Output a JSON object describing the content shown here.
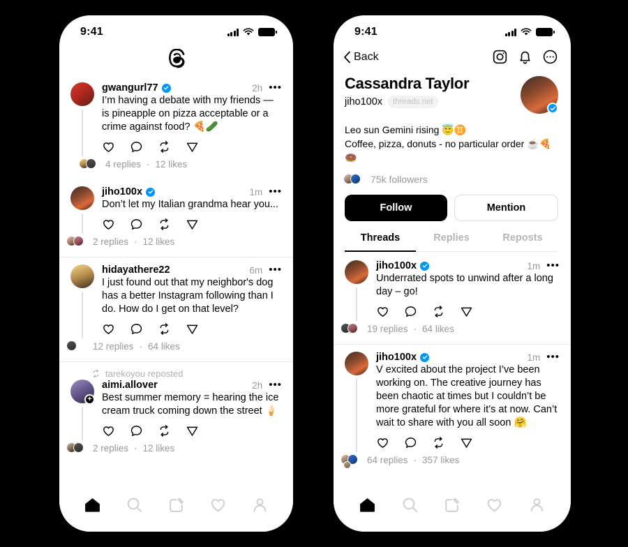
{
  "colors": {
    "accent_verified": "#0095f6",
    "text_primary": "#000000",
    "text_muted": "#999999",
    "background": "#000000",
    "phone_bg": "#ffffff",
    "divider": "#e8e8e8"
  },
  "left_phone": {
    "status": {
      "time": "9:41",
      "signal_icon": "cellular-bars-icon",
      "wifi_icon": "wifi-icon",
      "battery_icon": "battery-full-icon"
    },
    "header": {
      "logo_icon": "threads-logo-icon"
    },
    "posts": [
      {
        "username": "gwangurl77",
        "verified": true,
        "time": "2h",
        "text": "I’m having a debate with my friends — is pineapple on pizza acceptable or a crime against food? 🍕🥒",
        "replies": "4 replies",
        "likes": "12 likes",
        "separator": "·",
        "reposted_by": null,
        "has_plus_badge": false,
        "avatar_class": "av1",
        "facepile": [
          "av3",
          "av9"
        ]
      },
      {
        "username": "jiho100x",
        "verified": true,
        "time": "1m",
        "text": "Don’t let my Italian grandma hear you...",
        "replies": "2 replies",
        "likes": "12 likes",
        "separator": "·",
        "reposted_by": null,
        "has_plus_badge": false,
        "avatar_class": "av2",
        "facepile": [
          "av7",
          "av8"
        ]
      },
      {
        "username": "hidayathere22",
        "verified": false,
        "time": "6m",
        "text": "I just found out that my neighbor's dog has a better Instagram following than I do. How do I get on that level?",
        "replies": "12 replies",
        "likes": "64 likes",
        "separator": "·",
        "reposted_by": null,
        "has_plus_badge": false,
        "avatar_class": "av3",
        "facepile": [
          "av9"
        ]
      },
      {
        "username": "aimi.allover",
        "verified": false,
        "time": "2h",
        "text": "Best summer memory = hearing the ice cream truck coming down the street 🍦",
        "replies": "2 replies",
        "likes": "12 likes",
        "separator": "·",
        "reposted_by": "tarekoyou reposted",
        "has_plus_badge": true,
        "avatar_class": "av4",
        "facepile": [
          "av5",
          "av9"
        ]
      }
    ],
    "actions": [
      "like-icon",
      "comment-icon",
      "repost-icon",
      "share-icon"
    ],
    "bottom_nav": [
      "home-icon",
      "search-icon",
      "compose-icon",
      "activity-icon",
      "profile-icon"
    ],
    "bottom_nav_active": "home-icon"
  },
  "right_phone": {
    "status": {
      "time": "9:41",
      "signal_icon": "cellular-bars-icon",
      "wifi_icon": "wifi-icon",
      "battery_icon": "battery-full-icon"
    },
    "header": {
      "back_label": "Back",
      "back_icon": "chevron-left-icon",
      "icons": [
        "instagram-icon",
        "bell-icon",
        "more-circle-icon"
      ]
    },
    "profile": {
      "name": "Cassandra Taylor",
      "handle": "jiho100x",
      "network_chip": "threads.net",
      "verified": true,
      "bio_line1": "Leo sun Gemini rising 😇♊️",
      "bio_line2": "Coffee, pizza, donuts - no particular order ☕🍕🍩",
      "followers": "75k followers",
      "follow_button": "Follow",
      "mention_button": "Mention"
    },
    "tabs": [
      {
        "label": "Threads",
        "active": true
      },
      {
        "label": "Replies",
        "active": false
      },
      {
        "label": "Reposts",
        "active": false
      }
    ],
    "posts": [
      {
        "username": "jiho100x",
        "verified": true,
        "time": "1m",
        "text": "Underrated spots to unwind after a long day – go!",
        "replies": "19 replies",
        "likes": "64 likes",
        "separator": "·",
        "avatar_class": "av2",
        "facepile": [
          "av9",
          "av8"
        ]
      },
      {
        "username": "jiho100x",
        "verified": true,
        "time": "1m",
        "text": "V excited about the project I’ve been working on. The creative journey has been chaotic at times but I couldn’t be more grateful for where it’s at now. Can’t wait to share with you all soon 🤗",
        "replies": "64 replies",
        "likes": "357 likes",
        "separator": "·",
        "avatar_class": "av2",
        "facepile": [
          "av7",
          "av6",
          "av10"
        ]
      }
    ],
    "actions": [
      "like-icon",
      "comment-icon",
      "repost-icon",
      "share-icon"
    ],
    "bottom_nav": [
      "home-icon",
      "search-icon",
      "compose-icon",
      "activity-icon",
      "profile-icon"
    ],
    "bottom_nav_active": "home-icon"
  }
}
